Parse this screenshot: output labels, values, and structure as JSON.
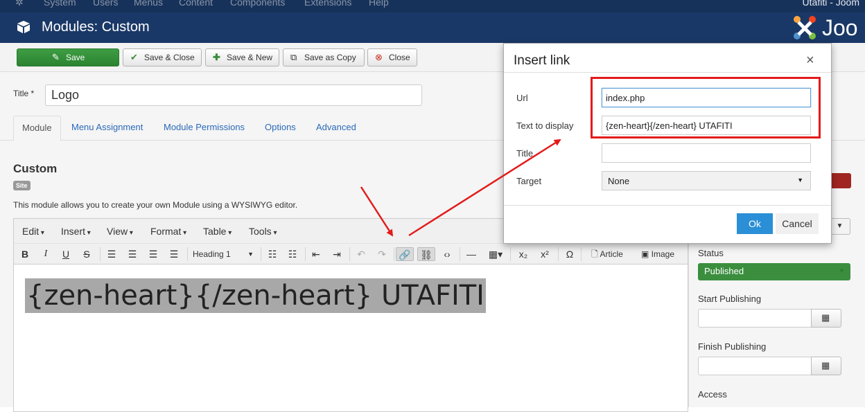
{
  "system_bar": {
    "items": [
      "System",
      "Users",
      "Menus",
      "Content",
      "Components",
      "Extensions",
      "Help"
    ],
    "site_name": "Utafiti - Joom"
  },
  "title_bar": {
    "title": "Modules: Custom",
    "logo_text": "Joo"
  },
  "toolbar": {
    "save": "Save",
    "save_close": "Save & Close",
    "save_new": "Save & New",
    "save_copy": "Save as Copy",
    "close": "Close"
  },
  "form": {
    "title_label": "Title *",
    "title_value": "Logo",
    "tabs": [
      "Module",
      "Menu Assignment",
      "Module Permissions",
      "Options",
      "Advanced"
    ],
    "heading": "Custom",
    "badge": "Site",
    "description": "This module allows you to create your own Module using a WYSIWYG editor."
  },
  "editor": {
    "menus": [
      "Edit",
      "Insert",
      "View",
      "Format",
      "Table",
      "Tools"
    ],
    "block_format": "Heading 1",
    "article_btn": "Article",
    "image_btn": "Image",
    "content": "{zen-heart}{/zen-heart} UTAFITI"
  },
  "sidebar": {
    "status_label": "Status",
    "status_value": "Published",
    "start_label": "Start Publishing",
    "finish_label": "Finish Publishing",
    "access_label": "Access"
  },
  "modal": {
    "title": "Insert link",
    "close": "×",
    "url_label": "Url",
    "url_value": "index.php",
    "text_label": "Text to display",
    "text_value": "{zen-heart}{/zen-heart} UTAFITI",
    "title_label": "Title",
    "title_value": "",
    "target_label": "Target",
    "target_value": "None",
    "ok": "Ok",
    "cancel": "Cancel"
  },
  "colors": {
    "header": "#1a3867",
    "save_green": "#2b8331",
    "ok_blue": "#2a8fd6",
    "annotation_red": "#e31b1b"
  }
}
